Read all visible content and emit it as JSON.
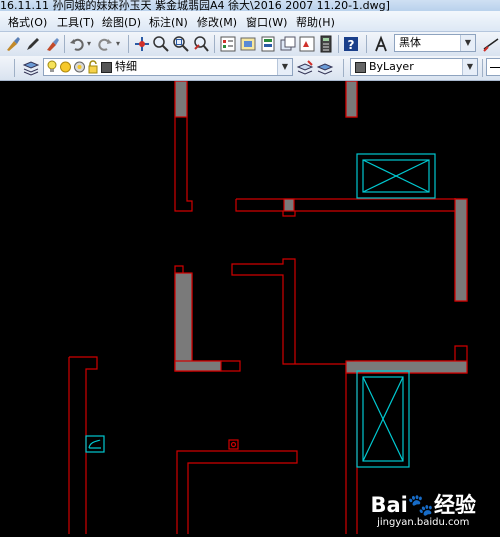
{
  "window": {
    "title": "16.11.11 孙同娥的妹妹孙玉天 紫金城翡园A4 徐大\\2016 2007  11.20-1.dwg]"
  },
  "menu": {
    "items": [
      {
        "label": "格式(O)",
        "name": "menu-format"
      },
      {
        "label": "工具(T)",
        "name": "menu-tools"
      },
      {
        "label": "绘图(D)",
        "name": "menu-draw"
      },
      {
        "label": "标注(N)",
        "name": "menu-dimension"
      },
      {
        "label": "修改(M)",
        "name": "menu-modify"
      },
      {
        "label": "窗口(W)",
        "name": "menu-window"
      },
      {
        "label": "帮助(H)",
        "name": "menu-help"
      }
    ]
  },
  "toolbar1": {
    "font_combo": "黑体"
  },
  "toolbar2": {
    "layer_combo": "特细",
    "color_combo": "ByLayer"
  },
  "watermark": {
    "logo": "Bai du 经验",
    "url": "jingyan.baidu.com"
  },
  "colors": {
    "wall_outline": "#d00000",
    "wall_fill": "#7a7a7a",
    "fixture": "#00c8d0",
    "canvas": "#000000"
  },
  "icons": [
    "undo-icon",
    "redo-icon",
    "pan-icon",
    "zoom-realtime-icon",
    "zoom-window-icon",
    "zoom-previous-icon",
    "properties-icon",
    "design-center-icon",
    "tool-palettes-icon",
    "sheet-set-icon",
    "markup-icon",
    "calculator-icon",
    "help-icon",
    "text-style-icon",
    "dimension-style-icon",
    "layer-manager-icon",
    "lightbulb-icon",
    "sun-icon",
    "lock-icon",
    "layer-color-icon",
    "make-current-icon",
    "layer-previous-icon"
  ]
}
